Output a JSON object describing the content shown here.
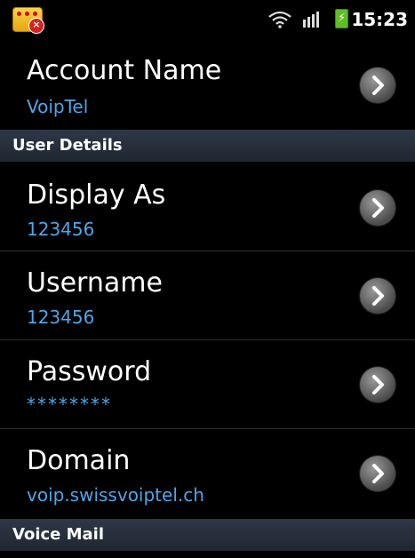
{
  "status_bar": {
    "time": "15:23",
    "icons": [
      "app-notification-icon",
      "wifi-icon",
      "signal-icon",
      "battery-charging-icon"
    ]
  },
  "account": {
    "title": "Account Name",
    "value": "VoipTel"
  },
  "sections": {
    "user_details": "User Details",
    "voice_mail": "Voice Mail"
  },
  "user_details": [
    {
      "title": "Display As",
      "value": "123456"
    },
    {
      "title": "Username",
      "value": "123456"
    },
    {
      "title": "Password",
      "value": "********"
    },
    {
      "title": "Domain",
      "value": "voip.swissvoiptel.ch"
    }
  ],
  "colors": {
    "background": "#000000",
    "value_text": "#4ea6ea",
    "section_header": "#27303c"
  }
}
